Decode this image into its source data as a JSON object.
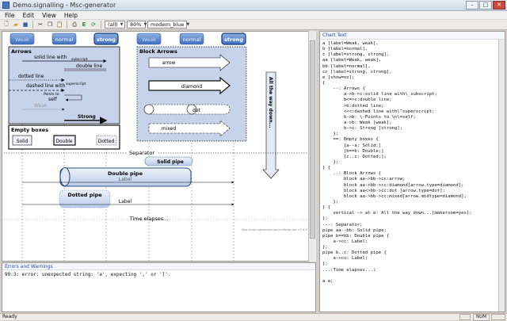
{
  "window": {
    "title": "Demo.signalling - Msc-generator"
  },
  "menu": [
    "File",
    "Edit",
    "View",
    "Help"
  ],
  "toolbar": {
    "design": "(all)",
    "zoom": "80%",
    "color_scheme": "modern_blue"
  },
  "chart_pane_title": "Chart Text",
  "errors_pane_title": "Errors and Warnings",
  "errors": [
    "99:3: error: unexpected string: 'a', expecting ',' or ']'."
  ],
  "status": {
    "ready": "Ready",
    "num": "NUM"
  },
  "diagram": {
    "entities": [
      "Weak",
      "normal",
      "strong",
      "Weak",
      "normal",
      "strong"
    ],
    "box_arrows": {
      "title": "Arrows",
      "labels": [
        "solid line with",
        "subscript",
        "double line",
        "dotted line",
        "dashed line with",
        "superscript",
        "Points to",
        "self",
        "Weak",
        "Strong"
      ]
    },
    "box_block": {
      "title": "Block Arrows",
      "labels": [
        "arrow",
        "diamond",
        "dot",
        "mixed"
      ]
    },
    "box_empty": {
      "title": "Empty boxes",
      "labels": [
        "Solid",
        "Double",
        "Dotted"
      ]
    },
    "vertical_text": "All the way down...",
    "separator": "Separator",
    "solid_pipe": "Solid pipe",
    "double_pipe": "Double pipe",
    "double_pipe_label": "Label",
    "dotted_pipe": "Dotted pipe",
    "dotted_pipe_label": "Label",
    "time_elapses": "Time elapses...",
    "watermark": "http://msc-generator.sourceforge.net v2.4.6"
  },
  "code_lines": [
    "a [label=Weak, weak],",
    "b [label=normal],",
    "c [label=strong, strong],",
    "aa [label=Weak, weak],",
    "bb [label=normal],",
    "cc [label=strong, strong],",
    "e [show=no];",
    "{",
    "    --: Arrows {",
    "        a->b->c:solid line with\\_subscript;",
    "        b<=>c:double line;",
    "        >b:dotted line;",
    "        <<<:dashed line with\\^superscript;",
    "        b->b: \\-Points to \\n\\=self;",
    "        a->b: Weak [weak];",
    "        b->c: Strong [strong];",
    "    };",
    "    ==: Empty boxes {",
    "        [a--a: Solid;]",
    "        [b==b: Double;]",
    "        [c..c: Dotted;];",
    "    };",
    "} {",
    "    ..: Block Arrows {",
    "        block aa->bb->cc:arrow;",
    "        block aa->bb->cc:diamond[arrow.type=diamond];",
    "        block aa<>bb->cc:dot [arrow.type=dot];",
    "        block aa->bb->cc:mixed[arrow.midtype=diamond];",
    "    };",
    "} {",
    "    vertical -> at e: All the way down...[makeroom=yes];",
    "};",
    "---: Separator;",
    "pipe aa--bb: Solid pipe;",
    "pipe b==bb: Double pipe {",
    "    a->cc: Label;",
    "};",
    "pipe b..c: Dotted pipe {",
    "    a->cc: Label;",
    "};",
    "...:Time elapses...;",
    "",
    "a a;"
  ]
}
